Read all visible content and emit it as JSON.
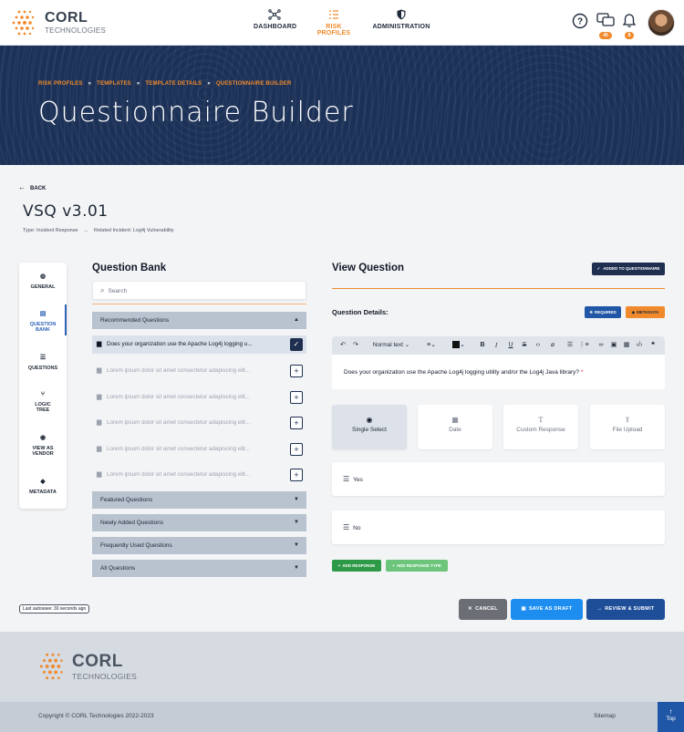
{
  "brand": {
    "name": "CORL",
    "sub": "TECHNOLOGIES"
  },
  "nav": {
    "items": [
      {
        "label": "DASHBOARD",
        "icon": "hub-icon"
      },
      {
        "label": "RISK PROFILES",
        "icon": "list-icon",
        "active": true
      },
      {
        "label": "ADMINISTRATION",
        "icon": "shield-icon"
      }
    ],
    "chat_badge": "45",
    "bell_badge": "8"
  },
  "breadcrumb": [
    "RISK PROFILES",
    "TEMPLATES",
    "TEMPLATE DETAILS",
    "QUESTIONNAIRE BUILDER"
  ],
  "page_title": "Questionnaire Builder",
  "back_label": "BACK",
  "questionnaire": {
    "name": "VSQ v3.01",
    "type": "Type: Incident Response",
    "related": "Related Incident: Log4j Vulnerability"
  },
  "sidenav": [
    {
      "label": "GENERAL",
      "icon": "globe-icon"
    },
    {
      "label": "QUESTION BANK",
      "icon": "book-icon",
      "active": true
    },
    {
      "label": "QUESTIONS",
      "icon": "list-icon"
    },
    {
      "label": "LOGIC TREE",
      "icon": "tree-icon"
    },
    {
      "label": "VIEW AS VENDOR",
      "icon": "eye-icon"
    },
    {
      "label": "METADATA",
      "icon": "tag-icon"
    }
  ],
  "question_bank": {
    "title": "Question Bank",
    "search_placeholder": "Search",
    "recommended_label": "Recommended Questions",
    "questions": [
      {
        "text": "Does your organization use the Apache Log4j logging u...",
        "selected": true
      },
      {
        "text": "Lorem ipsum dolor sit amet consectetur adapiscing elit..."
      },
      {
        "text": "Lorem ipsum dolor sit amet consectetur adapiscing elit..."
      },
      {
        "text": "Lorem ipsum dolor sit amet consectetur adapiscing elit..."
      },
      {
        "text": "Lorem ipsum dolor sit amet consectetur adapiscing elit..."
      },
      {
        "text": "Lorem ipsum dolor sit amet consectetur adapiscing elit..."
      }
    ],
    "sections": [
      "Featured Questions",
      "Newly Added Questions",
      "Frequently Used Questions",
      "All Questions"
    ]
  },
  "view_question": {
    "title": "View Question",
    "added_label": "ADDED TO QUESTIONNAIRE",
    "details_label": "Question Details:",
    "required_label": "REQUIRED",
    "metadata_label": "METADATA",
    "format_label": "Normal text",
    "question_text": "Does your organization use the Apache Log4j logging utility and/or the Log4j Java library?",
    "required_mark": "*",
    "response_types": [
      {
        "label": "Single Select",
        "icon": "radio-icon",
        "active": true
      },
      {
        "label": "Date",
        "icon": "calendar-icon"
      },
      {
        "label": "Custom Response",
        "icon": "text-icon"
      },
      {
        "label": "File Upload",
        "icon": "upload-icon"
      }
    ],
    "responses": [
      "Yes",
      "No"
    ],
    "add_response_label": "ADD RESPONSE",
    "add_response_type_label": "ADD RESPONSE TYPE"
  },
  "autosave": "Last autosave: 30 seconds ago",
  "actions": {
    "cancel": "CANCEL",
    "draft": "SAVE AS DRAFT",
    "submit": "REVIEW & SUBMIT"
  },
  "footer": {
    "copyright": "Copyright © CORL Technologies 2022-2023",
    "sitemap": "Sitemap",
    "top": "Top"
  },
  "colors": {
    "accent": "#f08a2c",
    "navy": "#1e2f50",
    "blue": "#1f56a6",
    "green": "#2e9a47",
    "hero": "#1c3157"
  }
}
